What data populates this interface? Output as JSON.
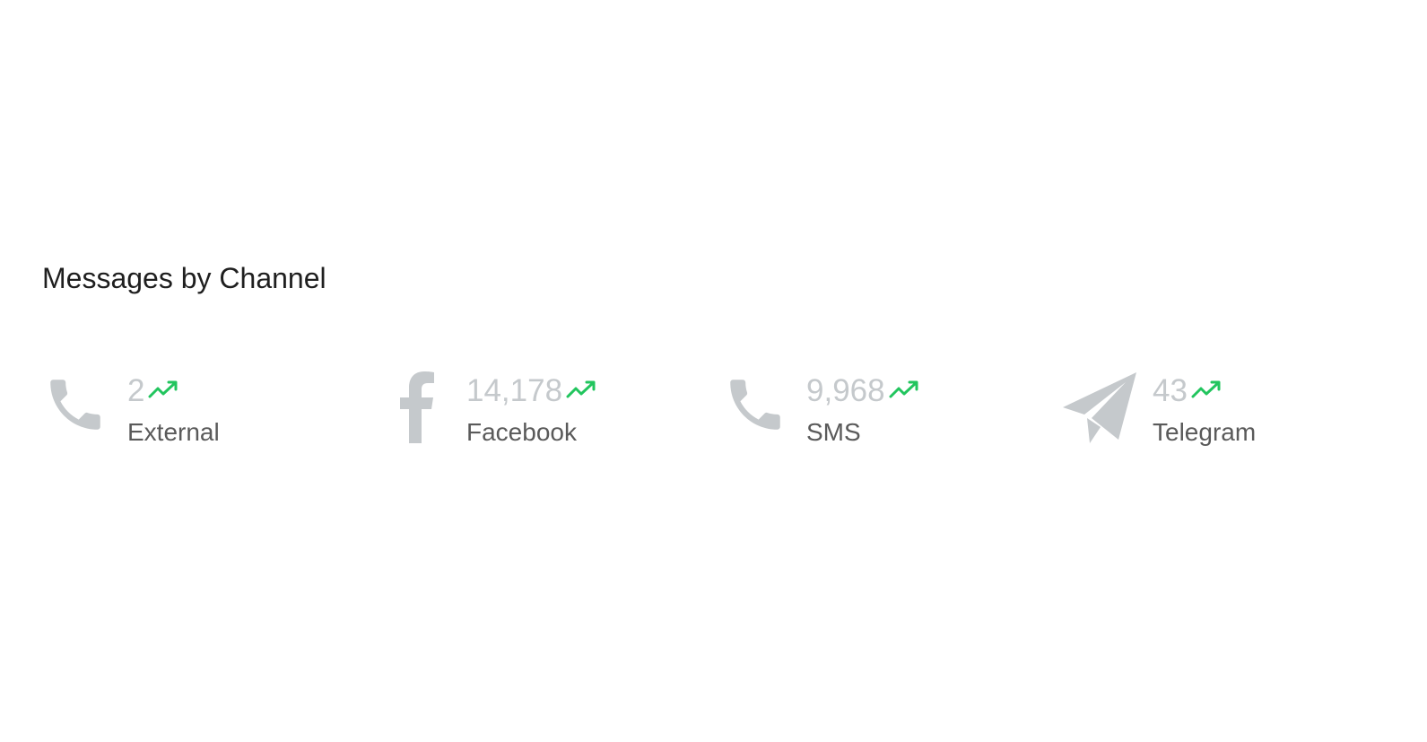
{
  "widget": {
    "title": "Messages by Channel"
  },
  "channels": [
    {
      "label": "External",
      "value": "2",
      "icon": "phone-icon",
      "trend": "trending-up-icon"
    },
    {
      "label": "Facebook",
      "value": "14,178",
      "icon": "facebook-icon",
      "trend": "trending-up-icon"
    },
    {
      "label": "SMS",
      "value": "9,968",
      "icon": "phone-icon",
      "trend": "trending-up-icon"
    },
    {
      "label": "Telegram",
      "value": "43",
      "icon": "telegram-icon",
      "trend": "trending-up-icon"
    }
  ],
  "colors": {
    "icon": "#c5c9cc",
    "value": "#c5c9cc",
    "label": "#5a5a5a",
    "trend_up": "#22c55e",
    "title": "#1f1f1f"
  }
}
